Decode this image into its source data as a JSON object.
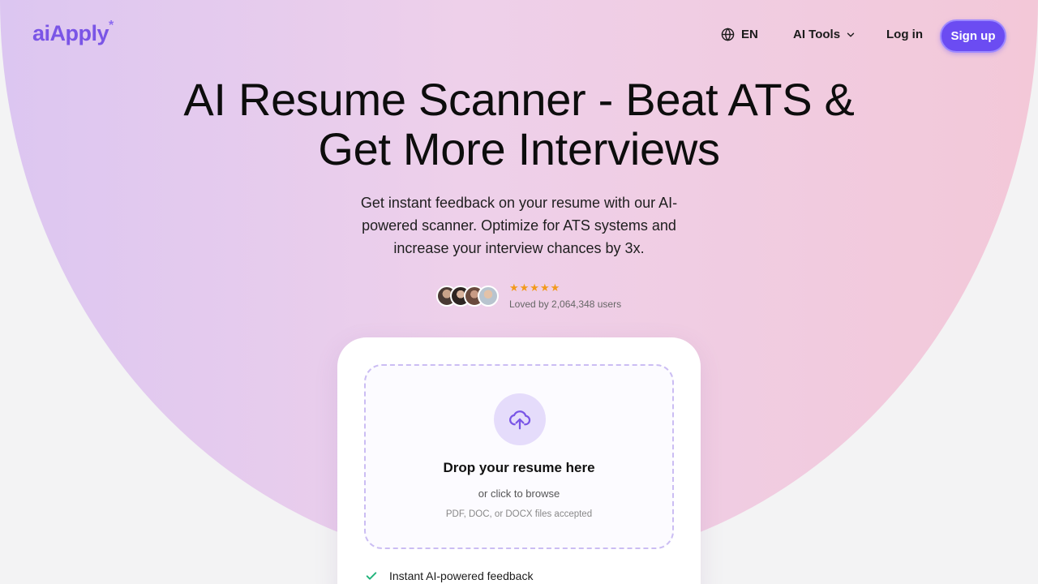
{
  "header": {
    "logo_text": "aiApply",
    "logo_mark": "*",
    "lang_label": "EN",
    "tools_label": "AI Tools",
    "login_label": "Log in",
    "signup_label": "Sign up"
  },
  "hero": {
    "title_line1": "AI Resume Scanner - Beat ATS &",
    "title_line2": "Get More Interviews",
    "subtitle": "Get instant feedback on your resume with our AI-powered scanner. Optimize for ATS systems and increase your interview chances by 3x.",
    "stars": "★★★★★",
    "loved": "Loved by 2,064,348 users"
  },
  "upload": {
    "title": "Drop your resume here",
    "sub": "or click to browse",
    "formats": "PDF, DOC, or DOCX files accepted"
  },
  "features": [
    {
      "label": "Instant AI-powered feedback"
    }
  ],
  "colors": {
    "accent": "#6b4cf2",
    "logo": "#7a55e6",
    "star": "#f29a1d",
    "check": "#1fb37a"
  },
  "icons": {
    "lang": "globe-icon",
    "tools": "chevron-down-icon",
    "upload": "cloud-upload-icon",
    "feature": "check-icon"
  }
}
